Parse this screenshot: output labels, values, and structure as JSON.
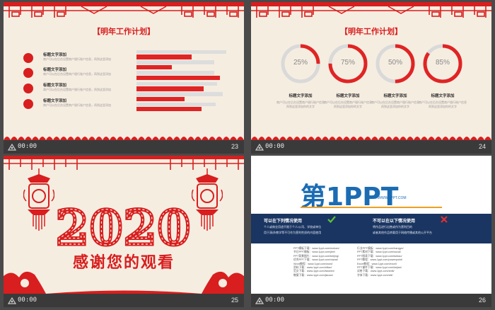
{
  "thumbnails": [
    {
      "time": "00:00",
      "number": "23",
      "title": "【明年工作计划】",
      "items": [
        {
          "title": "标题文字添加",
          "desc": "商户可以在后台设置商户银行账户信息，再到这里添加"
        },
        {
          "title": "标题文字添加",
          "desc": "商户可以在后台设置商户银行账户信息，再到这里添加"
        },
        {
          "title": "标题文字添加",
          "desc": "商户可以在后台设置商户银行账户信息，再到这里添加"
        },
        {
          "title": "标题文字添加",
          "desc": "商户可以在后台设置商户银行账户信息，再到这里添加"
        }
      ]
    },
    {
      "time": "00:00",
      "number": "24",
      "title": "【明年工作计划】",
      "rings": [
        {
          "label": "25%",
          "value": 25
        },
        {
          "label": "75%",
          "value": 75
        },
        {
          "label": "50%",
          "value": 50
        },
        {
          "label": "85%",
          "value": 85
        }
      ],
      "columns": [
        {
          "title": "标题文字添加",
          "desc": "商户可以在后台设置商户银行账户信息再到这里添加你的文字"
        },
        {
          "title": "标题文字添加",
          "desc": "商户可以在后台设置商户银行账户信息再到这里添加你的文字"
        },
        {
          "title": "标题文字添加",
          "desc": "商户可以在后台设置商户银行账户信息再到这里添加你的文字"
        },
        {
          "title": "标题文字添加",
          "desc": "商户可以在后台设置商户银行账户信息再到这里添加你的文字"
        }
      ]
    },
    {
      "time": "00:00",
      "number": "25",
      "year": "2020",
      "thanks": "感谢您的观看"
    },
    {
      "time": "00:00",
      "number": "26",
      "logo_text": "第1PPT",
      "logo_url": "HTTP://WWW.1PPT.COM",
      "can_title": "可以在下列情况使用",
      "can_lines": [
        "个人或商业用途不限于个人/公司、学校或单位",
        "用于演讲/教学等不可作为营利性质的内容使用"
      ],
      "cannot_title": "不可以在以下情况使用",
      "cannot_lines": [
        "将作品进行出售或作为营利目的",
        "或者其他作品转载用于网络传播或其他公开平台"
      ],
      "links_left": [
        "PPT模板下载：www.1ppt.com/moban/",
        "节日PPT模板：www.1ppt.com/jieri/",
        "PPT背景图片：www.1ppt.com/beijing/",
        "优秀PPT下载：www.1ppt.com/xiazai/",
        "Word教程：www.1ppt.com/word/",
        "资料下载：www.1ppt.com/ziliao/",
        "范文下载：www.1ppt.com/fanwen/",
        "教案下载：www.1ppt.com/jiaoan/"
      ],
      "links_right": [
        "行业PPT模板：www.1ppt.com/hangye/",
        "PPT素材下载：www.1ppt.com/sucai/",
        "PPT图表下载：www.1ppt.com/tubiao/",
        "PPT教程：www.1ppt.com/powerpoint/",
        "Excel教程：www.1ppt.com/excel/",
        "PPT课件下载：www.1ppt.com/kejian/",
        "试卷下载：www.1ppt.com/shiti/",
        "字体下载：www.1ppt.com/ziti/"
      ]
    }
  ],
  "colors": {
    "accent": "#d81e1e",
    "background": "#4a4a4a",
    "slide_bg": "#f6ede1",
    "band": "#1a3561"
  },
  "icons": {
    "meta": "transition-icon"
  }
}
